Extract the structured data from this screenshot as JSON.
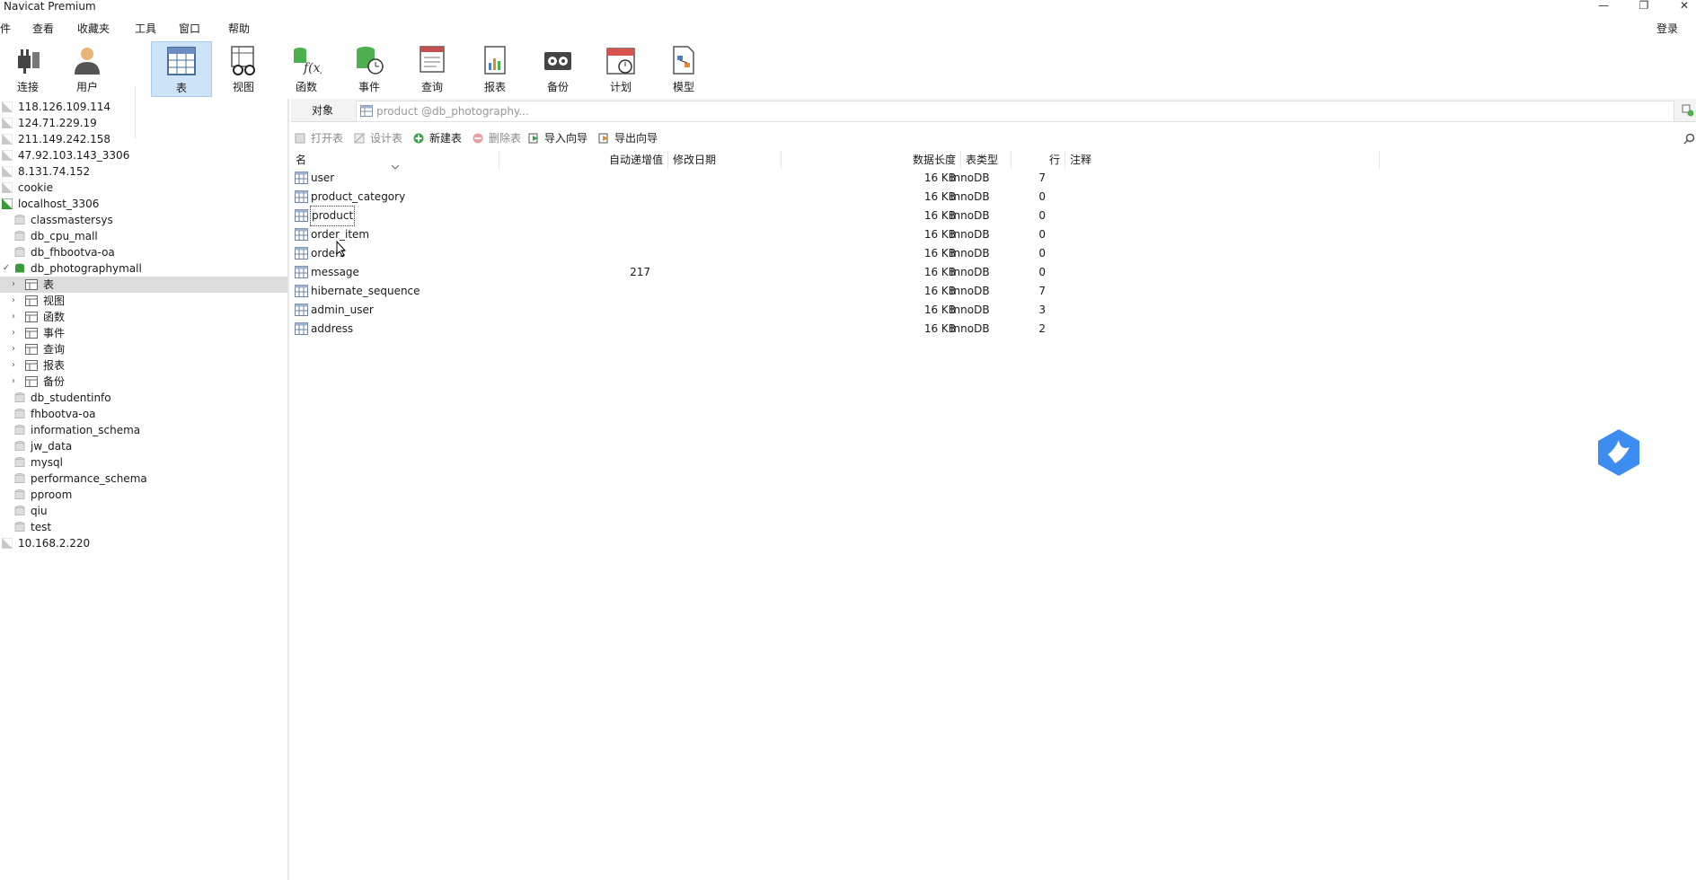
{
  "window": {
    "title": "Navicat Premium",
    "min_glyph": "—",
    "restore_glyph": "❐",
    "close_glyph": "✕"
  },
  "menu": [
    "件",
    "查看",
    "收藏夹",
    "工具",
    "窗口",
    "帮助"
  ],
  "login_label": "登录",
  "toolbar": [
    {
      "label": "连接",
      "icon": "plug-icon"
    },
    {
      "label": "用户",
      "icon": "user-icon"
    },
    {
      "label": "表",
      "icon": "table-icon",
      "active": true
    },
    {
      "label": "视图",
      "icon": "view-glasses-icon"
    },
    {
      "label": "函数",
      "icon": "function-icon"
    },
    {
      "label": "事件",
      "icon": "event-clock-icon"
    },
    {
      "label": "查询",
      "icon": "query-icon"
    },
    {
      "label": "报表",
      "icon": "report-icon"
    },
    {
      "label": "备份",
      "icon": "backup-icon"
    },
    {
      "label": "计划",
      "icon": "calendar-icon"
    },
    {
      "label": "模型",
      "icon": "model-icon"
    }
  ],
  "sidebar": {
    "connections_top": [
      "118.126.109.114",
      "124.71.229.19",
      "211.149.242.158",
      "47.92.103.143_3306",
      "8.131.74.152",
      "cookie"
    ],
    "open_connection": "localhost_3306",
    "databases_before": [
      "classmastersys",
      "db_cpu_mall",
      "db_fhbootva-oa"
    ],
    "open_database": "db_photographymall",
    "db_children": [
      "表",
      "视图",
      "函数",
      "事件",
      "查询",
      "报表",
      "备份"
    ],
    "databases_after": [
      "db_studentinfo",
      "fhbootva-oa",
      "information_schema",
      "jw_data",
      "mysql",
      "performance_schema",
      "pproom",
      "qiu",
      "test"
    ],
    "connections_bottom": [
      "10.168.2.220"
    ]
  },
  "tabs": {
    "objects": "对象",
    "open_tab": "product @db_photography..."
  },
  "object_toolbar": {
    "open": "打开表",
    "design": "设计表",
    "new": "新建表",
    "delete": "删除表",
    "import": "导入向导",
    "export": "导出向导"
  },
  "grid": {
    "headers": {
      "name": "名",
      "auto_increment": "自动递增值",
      "modified": "修改日期",
      "data_length": "数据长度",
      "engine": "表类型",
      "rows": "行",
      "comment": "注释"
    },
    "rows": [
      {
        "name": "user",
        "auto_inc": "",
        "size": "16 KB",
        "engine": "InnoDB",
        "rows": "7"
      },
      {
        "name": "product_category",
        "auto_inc": "",
        "size": "16 KB",
        "engine": "InnoDB",
        "rows": "0"
      },
      {
        "name": "product",
        "auto_inc": "",
        "size": "16 KB",
        "engine": "InnoDB",
        "rows": "0"
      },
      {
        "name": "order_item",
        "auto_inc": "",
        "size": "16 KB",
        "engine": "InnoDB",
        "rows": "0"
      },
      {
        "name": "orders",
        "auto_inc": "",
        "size": "16 KB",
        "engine": "InnoDB",
        "rows": "0"
      },
      {
        "name": "message",
        "auto_inc": "217",
        "size": "16 KB",
        "engine": "InnoDB",
        "rows": "0"
      },
      {
        "name": "hibernate_sequence",
        "auto_inc": "",
        "size": "16 KB",
        "engine": "InnoDB",
        "rows": "7"
      },
      {
        "name": "admin_user",
        "auto_inc": "",
        "size": "16 KB",
        "engine": "InnoDB",
        "rows": "3"
      },
      {
        "name": "address",
        "auto_inc": "",
        "size": "16 KB",
        "engine": "InnoDB",
        "rows": "2"
      }
    ]
  },
  "colors": {
    "active_tool_bg": "#cde3f7",
    "selected_tree_bg": "#dcdcdc",
    "db_open_green": "#3a9b3a",
    "assistant_blue": "#3d8cf0"
  }
}
